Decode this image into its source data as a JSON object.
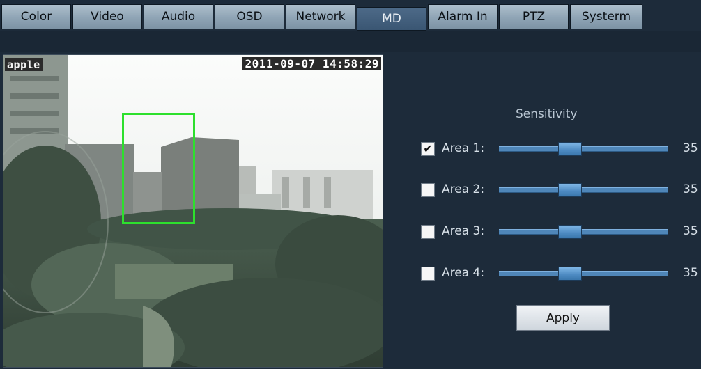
{
  "tabs": [
    {
      "label": "Color"
    },
    {
      "label": "Video"
    },
    {
      "label": "Audio"
    },
    {
      "label": "OSD"
    },
    {
      "label": "Network"
    },
    {
      "label": "MD"
    },
    {
      "label": "Alarm In"
    },
    {
      "label": "PTZ"
    },
    {
      "label": "Systerm"
    }
  ],
  "active_tab": "MD",
  "video": {
    "osd_name": "apple",
    "osd_datetime": "2011-09-07 14:58:29"
  },
  "sensitivity": {
    "title": "Sensitivity",
    "areas": [
      {
        "label": "Area 1:",
        "checked": true,
        "value": "35",
        "level": 0.35
      },
      {
        "label": "Area 2:",
        "checked": false,
        "value": "35",
        "level": 0.35
      },
      {
        "label": "Area 3:",
        "checked": false,
        "value": "35",
        "level": 0.35
      },
      {
        "label": "Area 4:",
        "checked": false,
        "value": "35",
        "level": 0.35
      }
    ]
  },
  "apply_label": "Apply",
  "colors": {
    "background": "#1d2b3a",
    "detection_box": "#2de02d",
    "slider": "#4f86b8"
  }
}
